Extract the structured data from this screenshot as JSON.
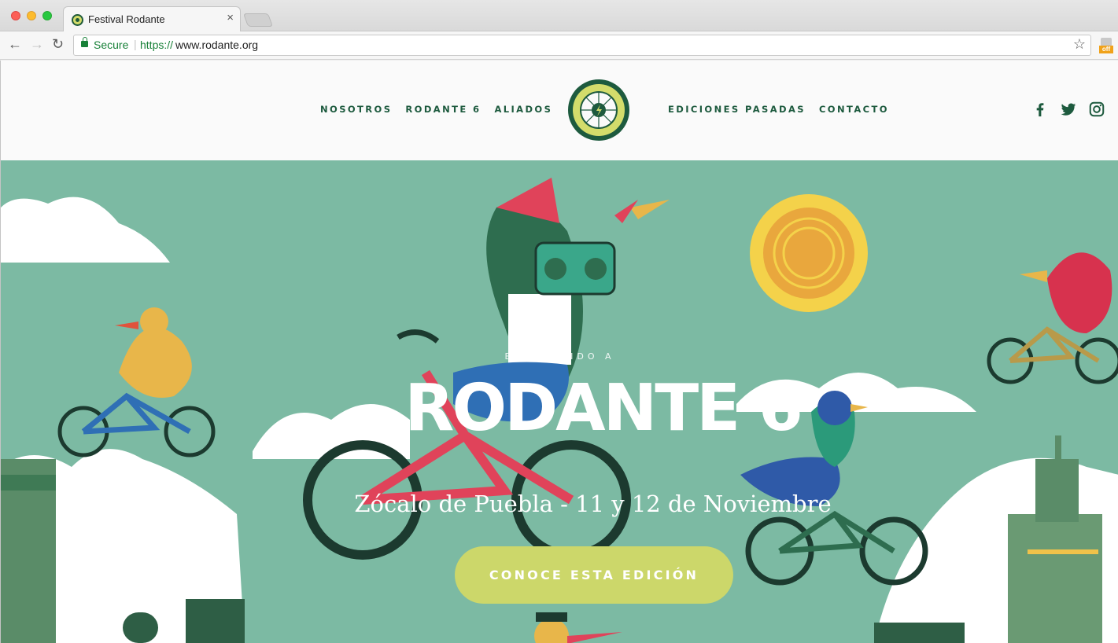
{
  "browser": {
    "tab_title": "Festival Rodante",
    "tab_close": "×",
    "secure_label": "Secure",
    "url_separator": "|",
    "url_scheme": "https://",
    "url_host": "www.rodante.org",
    "extension_badge": "off"
  },
  "site": {
    "menu_left": [
      "NOSOTROS",
      "RODANTE 6",
      "ALIADOS"
    ],
    "menu_right": [
      "EDICIONES PASADAS",
      "CONTACTO"
    ],
    "social": [
      "facebook-icon",
      "twitter-icon",
      "instagram-icon"
    ]
  },
  "hero": {
    "kicker": "BIENVENIDO A",
    "title": "RODANTE 6",
    "subtitle": "Zócalo de Puebla - 11 y 12 de Noviembre",
    "cta_label": "CONOCE ESTA EDICIÓN"
  },
  "colors": {
    "brand_green": "#1d5a3e",
    "hero_bg": "#7cbaa3",
    "cta_bg": "#ccd76a",
    "secure_green": "#188038"
  }
}
